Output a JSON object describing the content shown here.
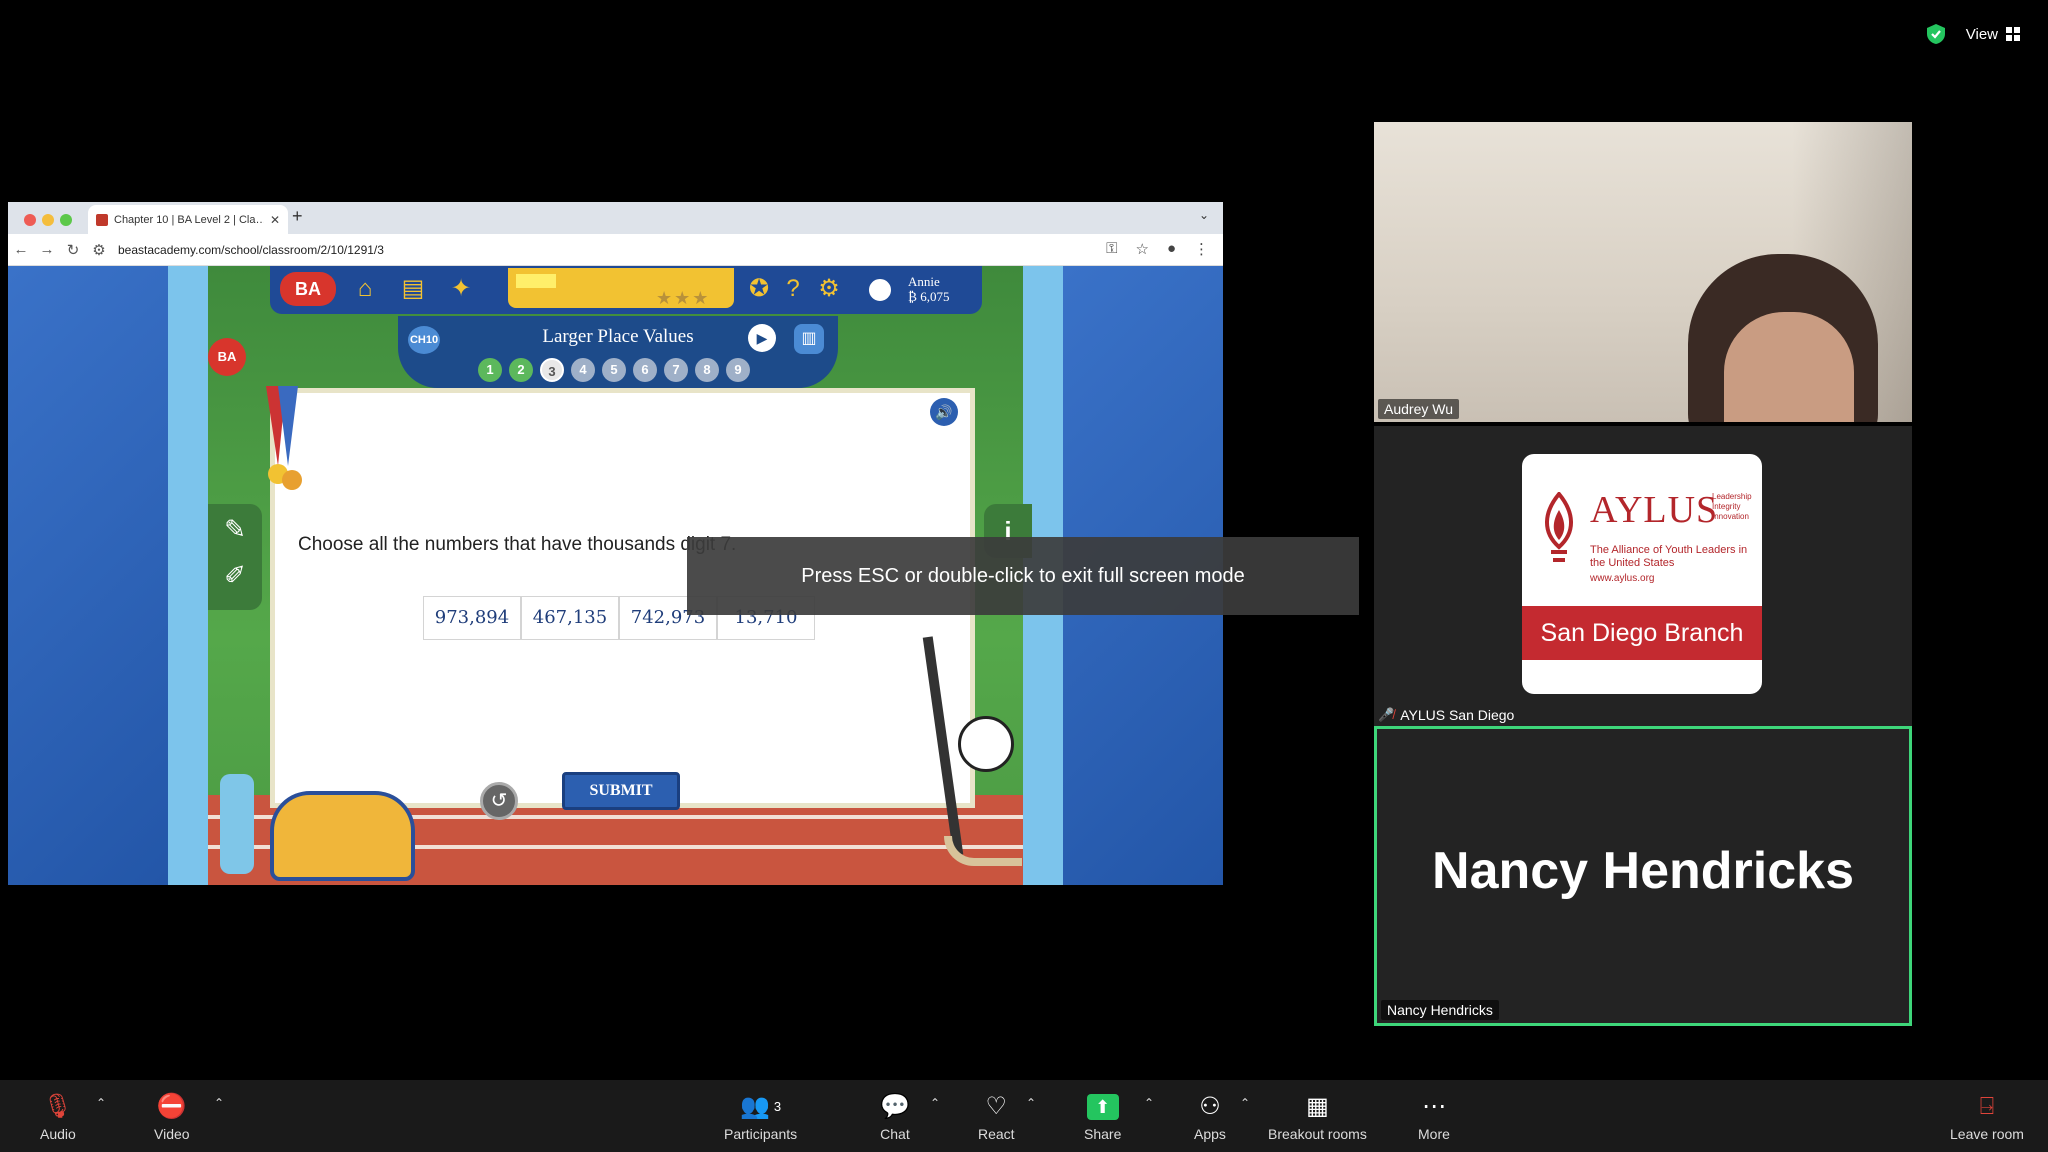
{
  "topbar": {
    "view_label": "View"
  },
  "browser": {
    "tab_title": "Chapter 10 | BA Level 2 | Cla…",
    "url": "beastacademy.com/school/classroom/2/10/1291/3"
  },
  "game": {
    "user_name": "Annie",
    "user_points": "₿ 6,075",
    "chapter_badge": "CH10",
    "lesson_title": "Larger Place Values",
    "steps": [
      "1",
      "2",
      "3",
      "4",
      "5",
      "6",
      "7",
      "8",
      "9"
    ],
    "question": "Choose all the numbers that have thousands digit 7.",
    "choices": [
      "973,894",
      "467,135",
      "742,973",
      "13,710"
    ],
    "submit_label": "SUBMIT",
    "logo_text": "BA"
  },
  "notice": {
    "text": "Press ESC or double-click to exit full screen mode"
  },
  "participants": {
    "audrey": {
      "name": "Audrey Wu"
    },
    "aylus": {
      "name": "AYLUS San Diego",
      "logo_title": "AYLUS",
      "logo_side": "Leadership Integrity Innovation",
      "logo_tagline": "The Alliance of Youth Leaders in the United States",
      "logo_url": "www.aylus.org",
      "logo_branch": "San Diego Branch"
    },
    "nancy": {
      "name": "Nancy Hendricks",
      "display": "Nancy Hendricks"
    }
  },
  "toolbar": {
    "audio": "Audio",
    "video": "Video",
    "participants": "Participants",
    "participants_count": "3",
    "chat": "Chat",
    "react": "React",
    "share": "Share",
    "apps": "Apps",
    "breakout": "Breakout rooms",
    "more": "More",
    "leave": "Leave room"
  }
}
